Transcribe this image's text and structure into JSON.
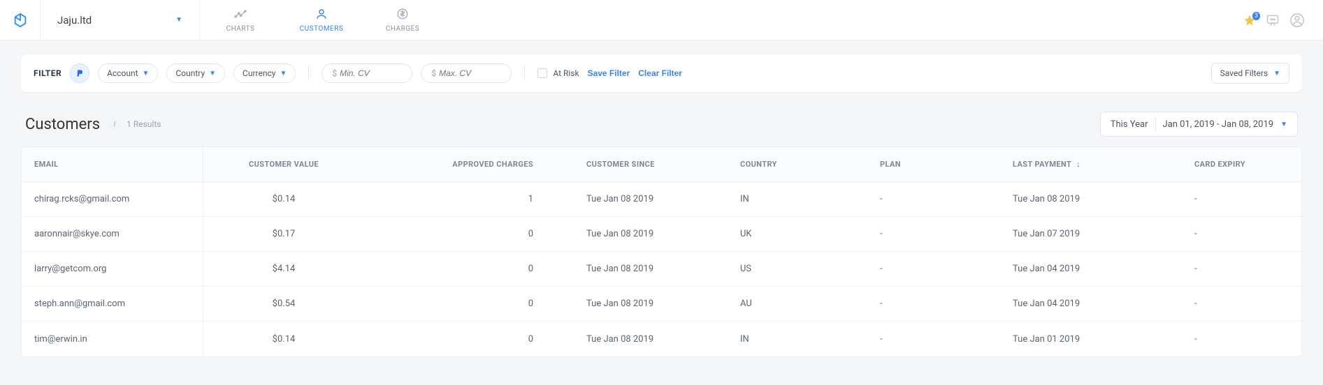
{
  "header": {
    "org_name": "Jaju.ltd",
    "tabs": {
      "charts": "CHARTS",
      "customers": "CUSTOMERS",
      "charges": "CHARGES"
    },
    "star_count": "3"
  },
  "filter": {
    "label": "FILTER",
    "account": "Account",
    "country": "Country",
    "currency": "Currency",
    "min_placeholder": "Min. CV",
    "max_placeholder": "Max. CV",
    "at_risk": "At Risk",
    "save": "Save Filter",
    "clear": "Clear Filter",
    "saved": "Saved Filters"
  },
  "title": {
    "heading": "Customers",
    "results": "1 Results",
    "period": "This Year",
    "range": "Jan 01, 2019 - Jan 08, 2019"
  },
  "columns": {
    "email": "EMAIL",
    "value": "CUSTOMER VALUE",
    "approved": "APPROVED CHARGES",
    "since": "CUSTOMER SINCE",
    "country": "COUNTRY",
    "plan": "PLAN",
    "last_payment": "LAST PAYMENT",
    "card_expiry": "CARD EXPIRY"
  },
  "rows": [
    {
      "email": "chirag.rcks@gmail.com",
      "value": "$0.14",
      "approved": "1",
      "since": "Tue Jan 08 2019",
      "country": "IN",
      "plan": "-",
      "last_payment": "Tue Jan 08 2019",
      "card_expiry": "-"
    },
    {
      "email": "aaronnair@skye.com",
      "value": "$0.17",
      "approved": "0",
      "since": "Tue Jan 08 2019",
      "country": "UK",
      "plan": "-",
      "last_payment": "Tue Jan 07 2019",
      "card_expiry": "-"
    },
    {
      "email": "larry@getcom.org",
      "value": "$4.14",
      "approved": "0",
      "since": "Tue Jan 08 2019",
      "country": "US",
      "plan": "-",
      "last_payment": "Tue Jan 04 2019",
      "card_expiry": "-"
    },
    {
      "email": "steph.ann@gmail.com",
      "value": "$0.54",
      "approved": "0",
      "since": "Tue Jan 08 2019",
      "country": "AU",
      "plan": "-",
      "last_payment": "Tue Jan 04 2019",
      "card_expiry": "-"
    },
    {
      "email": "tim@erwin.in",
      "value": "$0.14",
      "approved": "0",
      "since": "Tue Jan 08 2019",
      "country": "IN",
      "plan": "-",
      "last_payment": "Tue Jan 01 2019",
      "card_expiry": "-"
    }
  ]
}
